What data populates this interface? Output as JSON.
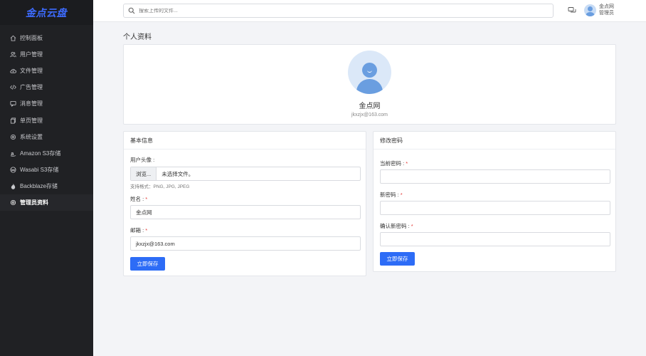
{
  "brand": {
    "logo_text": "金点云盘",
    "logo_color": "#3d6bff"
  },
  "sidebar": {
    "items": [
      {
        "label": "控制面板",
        "icon": "home-icon",
        "active": false
      },
      {
        "label": "用户管理",
        "icon": "users-icon",
        "active": false
      },
      {
        "label": "文件管理",
        "icon": "cloud-icon",
        "active": false
      },
      {
        "label": "广告管理",
        "icon": "code-icon",
        "active": false
      },
      {
        "label": "消息管理",
        "icon": "message-icon",
        "active": false
      },
      {
        "label": "单页管理",
        "icon": "pages-icon",
        "active": false
      },
      {
        "label": "系统设置",
        "icon": "gear-icon",
        "active": false
      },
      {
        "label": "Amazon S3存储",
        "icon": "amazon-icon",
        "active": false
      },
      {
        "label": "Wasabi S3存储",
        "icon": "wasabi-icon",
        "active": false
      },
      {
        "label": "Backblaze存储",
        "icon": "flame-icon",
        "active": false
      },
      {
        "label": "管理员资料",
        "icon": "gear-icon",
        "active": true
      }
    ]
  },
  "topbar": {
    "search_placeholder": "搜索上传的文件...",
    "user_name": "金点网",
    "user_role": "管理员"
  },
  "page": {
    "title": "个人资料"
  },
  "profile": {
    "name": "金点网",
    "email": "jkxzjx@163.com"
  },
  "basic_info": {
    "header": "基本信息",
    "avatar_label": "用户头像 :",
    "browse_label": "浏览...",
    "file_status": "未选择文件。",
    "format_hint": "支持格式：PNG, JPG, JPEG",
    "name_label": "姓名 :",
    "name_value": "金点网",
    "email_label": "邮箱 :",
    "email_value": "jkxzjx@163.com",
    "save_label": "立即保存"
  },
  "change_password": {
    "header": "修改密码",
    "current_label": "当前密码 :",
    "new_label": "新密码 :",
    "confirm_label": "确认新密码 :",
    "save_label": "立即保存"
  },
  "colors": {
    "primary": "#2d6cf6",
    "sidebar_bg": "#202124",
    "required": "#e53935"
  }
}
